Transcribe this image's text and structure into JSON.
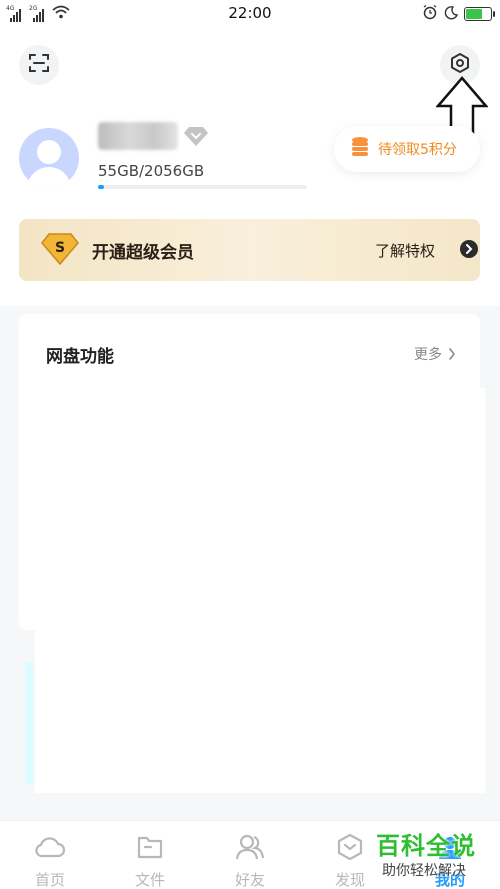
{
  "status_bar": {
    "time": "22:00",
    "sim1_tag": "4G",
    "sim2_tag": "2G",
    "icons": [
      "signal-icon",
      "wifi-icon",
      "alarm-icon",
      "moon-icon",
      "battery-icon"
    ]
  },
  "header": {
    "scan_icon": "scan-icon",
    "settings_icon": "settings-hexagon-icon"
  },
  "profile": {
    "username": "",
    "storage_text": "55GB/2056GB",
    "storage_used_fraction": 0.027,
    "points_label": "待领取5积分"
  },
  "vip_banner": {
    "title": "开通超级会员",
    "link": "了解特权",
    "badge_letter": "S"
  },
  "feature_card": {
    "title": "网盘功能",
    "more_label": "更多"
  },
  "tabbar": {
    "tabs": [
      {
        "label": "首页",
        "icon": "cloud-icon"
      },
      {
        "label": "文件",
        "icon": "folder-icon"
      },
      {
        "label": "好友",
        "icon": "friends-icon"
      },
      {
        "label": "发现",
        "icon": "discover-icon"
      },
      {
        "label": "我的",
        "icon": "profile-icon",
        "active": true
      }
    ]
  },
  "watermark": {
    "title": "百科全说",
    "subtitle": "助你轻松解决"
  },
  "colors": {
    "accent": "#1e9bff",
    "points_orange": "#f08a1d",
    "vip_gold": "#f3e4c4",
    "watermark_green": "#2dbf30"
  }
}
